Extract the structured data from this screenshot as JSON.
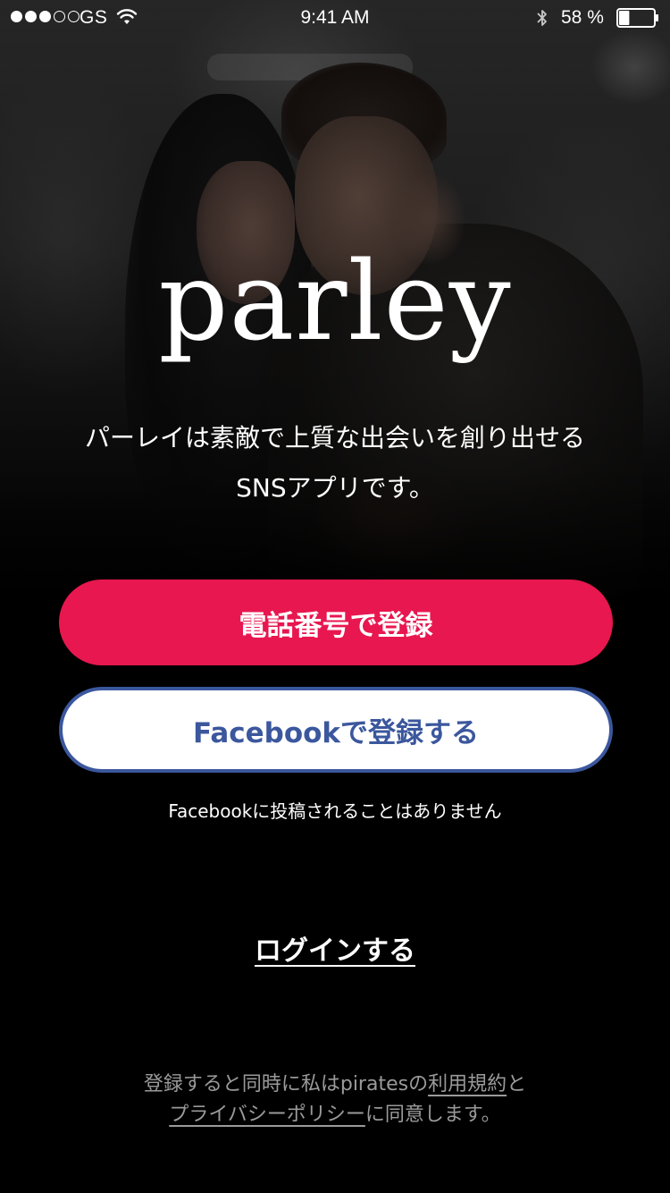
{
  "status_bar": {
    "signal_dots": [
      true,
      true,
      true,
      false,
      false
    ],
    "carrier": "GS",
    "time": "9:41 AM",
    "battery_percent": "58 %",
    "battery_level": 0.3,
    "icons": [
      "wifi-icon",
      "bluetooth-icon",
      "battery-icon"
    ]
  },
  "hero": {
    "logo_text": "parley",
    "tagline_line1": "パーレイは素敵で上質な出会いを創り出せる",
    "tagline_line2": "SNSアプリです。"
  },
  "actions": {
    "phone_signup_label": "電話番号で登録",
    "facebook_signup_label": "Facebookで登録する",
    "facebook_note": "Facebookに投稿されることはありません",
    "login_label": "ログインする"
  },
  "legal": {
    "prefix": "登録すると同時に私はpiratesの",
    "terms_link": "利用規約",
    "and": "と",
    "privacy_link": "プライバシーポリシー",
    "suffix": "に同意します。"
  },
  "colors": {
    "primary": "#e8174f",
    "facebook": "#3b579d",
    "background": "#000000",
    "text": "#ffffff",
    "legal_text": "#9a9a9a"
  }
}
